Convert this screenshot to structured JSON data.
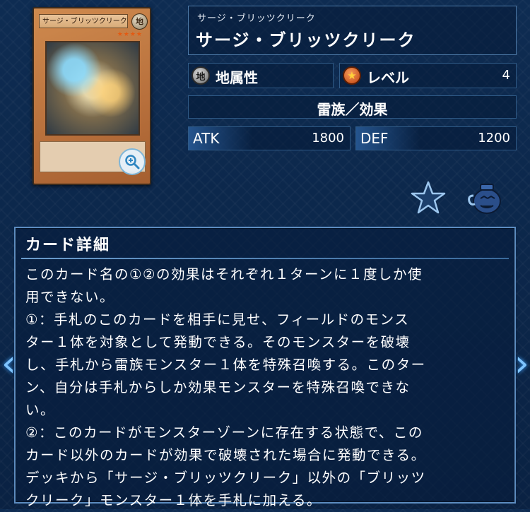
{
  "card": {
    "name_plate": "サージ・ブリッツクリーク",
    "attribute_glyph": "地",
    "stars": "★★★★",
    "level": 4
  },
  "header": {
    "ruby": "サージ・ブリッツクリーク",
    "name": "サージ・ブリッツクリーク"
  },
  "attribute": {
    "label": "地属性",
    "icon": "earth-attribute-icon",
    "glyph": "地"
  },
  "level": {
    "label": "レベル",
    "value": "4",
    "icon": "level-star-icon"
  },
  "type_line": "雷族／効果",
  "atk": {
    "label": "ATK",
    "value": "1800"
  },
  "def": {
    "label": "DEF",
    "value": "1200"
  },
  "detail": {
    "title": "カード詳細",
    "text": "このカード名の①②の効果はそれぞれ１ターンに１度しか使\n用できない。\n①：手札のこのカードを相手に見せ、フィールドのモンス\nター１体を対象として発動できる。そのモンスターを破壊\nし、手札から雷族モンスター１体を特殊召喚する。このター\nン、自分は手札からしか効果モンスターを特殊召喚できな\nい。\n②：このカードがモンスターゾーンに存在する状態で、この\nカード以外のカードが効果で破壊された場合に発動できる。\nデッキから「サージ・ブリッツクリーク」以外の「ブリッツ\nクリーク」モンスター１体を手札に加える。"
  },
  "icons": {
    "zoom": "zoom-in-icon",
    "favorite": "star-icon",
    "jar": "jar-icon",
    "prev": "chevron-left-icon",
    "next": "chevron-right-icon"
  },
  "colors": {
    "background": "#0b2647",
    "accent": "#5c8cc0",
    "arrow": "#7fc4ff"
  }
}
